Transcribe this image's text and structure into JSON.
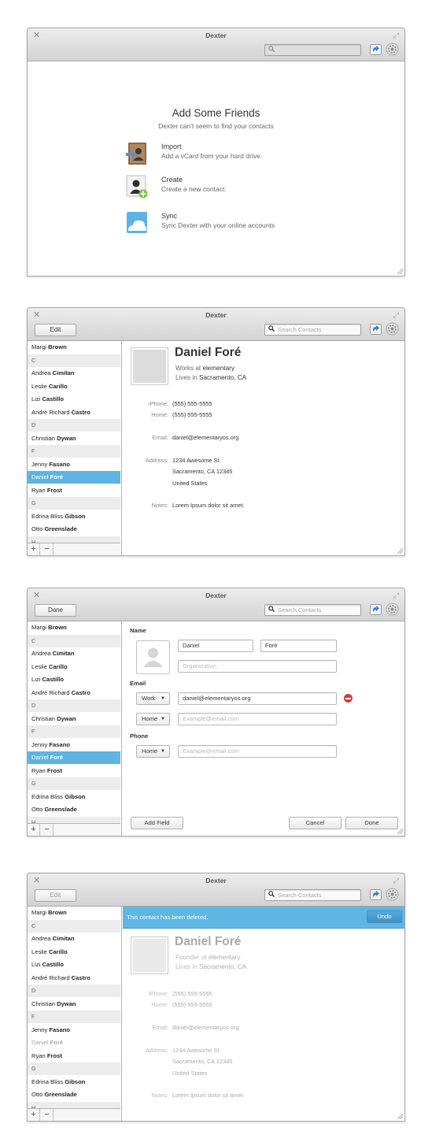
{
  "window": {
    "title": "Dexter"
  },
  "toolbar": {
    "edit_label": "Edit",
    "done_label": "Done",
    "search_placeholder": "Search Contacts"
  },
  "welcome": {
    "heading": "Add Some Friends",
    "subheading": "Dexter can't seem to find your contacts",
    "options": [
      {
        "title": "Import",
        "desc": "Add a vCard from your hard drive.",
        "icon": "vcard-import-icon"
      },
      {
        "title": "Create",
        "desc": "Create a new contact.",
        "icon": "create-contact-icon"
      },
      {
        "title": "Sync",
        "desc": "Sync Dexter with your online accounts",
        "icon": "cloud-sync-icon"
      }
    ]
  },
  "sidebar": {
    "rows": [
      {
        "type": "contact",
        "first": "Margi",
        "last": "Brown"
      },
      {
        "type": "header",
        "label": "C"
      },
      {
        "type": "contact",
        "first": "Andrea",
        "last": "Cimitan"
      },
      {
        "type": "contact",
        "first": "Leslie",
        "last": "Carillo"
      },
      {
        "type": "contact",
        "first": "Lizi",
        "last": "Castillo"
      },
      {
        "type": "contact",
        "first": "André Richard",
        "last": "Castro"
      },
      {
        "type": "header",
        "label": "D"
      },
      {
        "type": "contact",
        "first": "Christian",
        "last": "Dywan"
      },
      {
        "type": "header",
        "label": "F"
      },
      {
        "type": "contact",
        "first": "Jenny",
        "last": "Fasano"
      },
      {
        "type": "contact",
        "first": "Daniel",
        "last": "Foré",
        "selected": true
      },
      {
        "type": "contact",
        "first": "Ryan",
        "last": "Frost"
      },
      {
        "type": "header",
        "label": "G"
      },
      {
        "type": "contact",
        "first": "Edrina Bliss",
        "last": "Gibson"
      },
      {
        "type": "contact",
        "first": "Otto",
        "last": "Greenslade"
      },
      {
        "type": "header",
        "label": "H"
      }
    ],
    "add_label": "+",
    "remove_label": "−"
  },
  "contact": {
    "name": "Daniel Foré",
    "work_prefix": "Works at",
    "founder_prefix": "Founder at",
    "company": "elementary",
    "lives_prefix": "Lives in",
    "location": "Sacramento, CA",
    "iphone_label": "iPhone:",
    "iphone": "(555) 555-5555",
    "home_label": "Home:",
    "home": "(555) 555-5555",
    "email_label": "Email:",
    "email": "daniel@elementaryos.org",
    "address_label": "Address:",
    "address1": "1234 Awesome St.",
    "address2": "Sacramento, CA 12345",
    "address3": "United States",
    "notes_label": "Notes:",
    "notes": "Lorem Ipsum dolor sit amet."
  },
  "edit": {
    "name_section": "Name",
    "first": "Daniel",
    "last": "Foré",
    "org_placeholder": "Organization",
    "email_section": "Email",
    "work_type": "Work",
    "home_type": "Home",
    "email_value": "daniel@elementaryos.org",
    "email_placeholder": "Example@email.com",
    "phone_section": "Phone",
    "phone_placeholder": "Example@email.com",
    "add_field": "Add Field",
    "cancel": "Cancel",
    "done": "Done"
  },
  "infobar": {
    "message": "This contact has been deleted.",
    "undo": "Undo"
  },
  "colors": {
    "accent": "#5eb3e2",
    "infobar": "#5eb6e3",
    "delete": "#d83a3a"
  }
}
